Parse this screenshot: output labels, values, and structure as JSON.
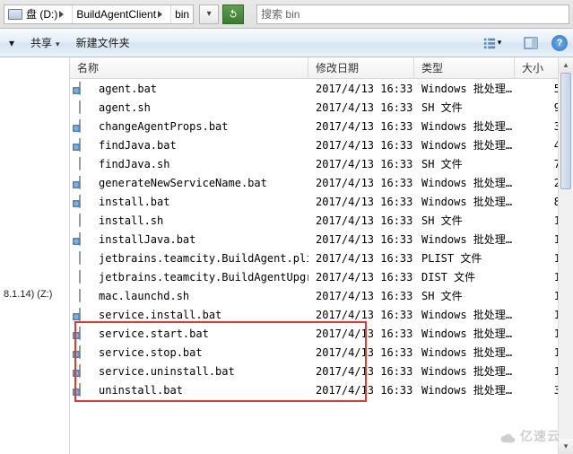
{
  "address": {
    "drive_label": "盘 (D:)",
    "segments": [
      "BuildAgentClient",
      "bin"
    ]
  },
  "search": {
    "placeholder": "搜索 bin"
  },
  "toolbar": {
    "share_label": "共享",
    "newfolder_label": "新建文件夹"
  },
  "columns": {
    "name": "名称",
    "date": "修改日期",
    "type": "类型",
    "size": "大小"
  },
  "sidebar": {
    "net_loc": "8.1.14) (Z:)"
  },
  "type_labels": {
    "bat": "Windows 批处理...",
    "sh": "SH 文件",
    "plist": "PLIST 文件",
    "dist": "DIST 文件"
  },
  "highlight_range": [
    13,
    16
  ],
  "files": [
    {
      "name": "agent.bat",
      "date": "2017/4/13 16:33",
      "icon": "bat",
      "type": "bat",
      "size": "5"
    },
    {
      "name": "agent.sh",
      "date": "2017/4/13 16:33",
      "icon": "plain",
      "type": "sh",
      "size": "9"
    },
    {
      "name": "changeAgentProps.bat",
      "date": "2017/4/13 16:33",
      "icon": "bat",
      "type": "bat",
      "size": "3"
    },
    {
      "name": "findJava.bat",
      "date": "2017/4/13 16:33",
      "icon": "bat",
      "type": "bat",
      "size": "4"
    },
    {
      "name": "findJava.sh",
      "date": "2017/4/13 16:33",
      "icon": "plain",
      "type": "sh",
      "size": "7"
    },
    {
      "name": "generateNewServiceName.bat",
      "date": "2017/4/13 16:33",
      "icon": "bat",
      "type": "bat",
      "size": "2"
    },
    {
      "name": "install.bat",
      "date": "2017/4/13 16:33",
      "icon": "bat",
      "type": "bat",
      "size": "8"
    },
    {
      "name": "install.sh",
      "date": "2017/4/13 16:33",
      "icon": "plain",
      "type": "sh",
      "size": "1"
    },
    {
      "name": "installJava.bat",
      "date": "2017/4/13 16:33",
      "icon": "bat",
      "type": "bat",
      "size": "1"
    },
    {
      "name": "jetbrains.teamcity.BuildAgent.plist",
      "date": "2017/4/13 16:33",
      "icon": "plain",
      "type": "plist",
      "size": "1"
    },
    {
      "name": "jetbrains.teamcity.BuildAgentUpgra...",
      "date": "2017/4/13 16:33",
      "icon": "plain",
      "type": "dist",
      "size": "1"
    },
    {
      "name": "mac.launchd.sh",
      "date": "2017/4/13 16:33",
      "icon": "plain",
      "type": "sh",
      "size": "1"
    },
    {
      "name": "service.install.bat",
      "date": "2017/4/13 16:33",
      "icon": "bat",
      "type": "bat",
      "size": "1"
    },
    {
      "name": "service.start.bat",
      "date": "2017/4/13 16:33",
      "icon": "bat",
      "type": "bat",
      "size": "1"
    },
    {
      "name": "service.stop.bat",
      "date": "2017/4/13 16:33",
      "icon": "bat",
      "type": "bat",
      "size": "1"
    },
    {
      "name": "service.uninstall.bat",
      "date": "2017/4/13 16:33",
      "icon": "bat",
      "type": "bat",
      "size": "1"
    },
    {
      "name": "uninstall.bat",
      "date": "2017/4/13 16:33",
      "icon": "bat",
      "type": "bat",
      "size": "3"
    }
  ],
  "watermark": "亿速云"
}
